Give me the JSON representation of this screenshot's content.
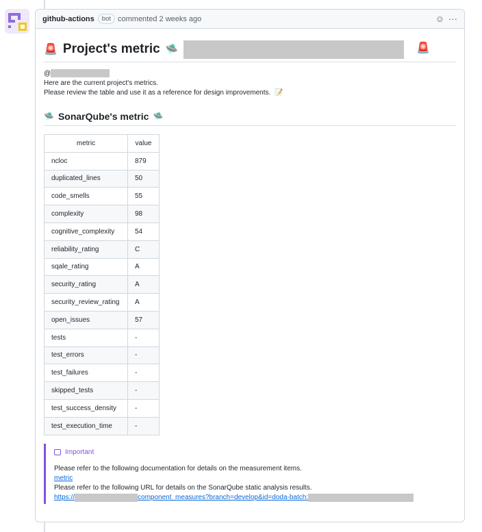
{
  "comment": {
    "author": "github-actions",
    "badge": "bot",
    "action": "commented 2 weeks ago",
    "icons": [
      "smiley-icon",
      "kebab-menu-icon"
    ],
    "icon_glyphs": {
      "smiley": "☺",
      "more": "···"
    }
  },
  "post": {
    "title": "Project's metric",
    "emoji": {
      "siren": "🚨",
      "ufo": "🛸",
      "memo": "📝"
    },
    "mention_prefix": "@",
    "intro_line1": "Here are the current project's metrics.",
    "intro_line2": "Please review the table and use it as a reference for design improvements.",
    "subheading": "SonarQube's metric"
  },
  "table": {
    "headers": [
      "metric",
      "value"
    ],
    "rows": [
      [
        "ncloc",
        "879"
      ],
      [
        "duplicated_lines",
        "50"
      ],
      [
        "code_smells",
        "55"
      ],
      [
        "complexity",
        "98"
      ],
      [
        "cognitive_complexity",
        "54"
      ],
      [
        "reliability_rating",
        "C"
      ],
      [
        "sqale_rating",
        "A"
      ],
      [
        "security_rating",
        "A"
      ],
      [
        "security_review_rating",
        "A"
      ],
      [
        "open_issues",
        "57"
      ],
      [
        "tests",
        "-"
      ],
      [
        "test_errors",
        "-"
      ],
      [
        "test_failures",
        "-"
      ],
      [
        "skipped_tests",
        "-"
      ],
      [
        "test_success_density",
        "-"
      ],
      [
        "test_execution_time",
        "-"
      ]
    ]
  },
  "alert": {
    "title": "Important",
    "line1": "Please refer to the following documentation for details on the measurement items.",
    "link1": "metric",
    "line2": "Please refer to the following URL for details on the SonarQube static analysis results.",
    "url_prefix": "https://",
    "url_middle": "component_measures?branch=develop&id=doda-batch:"
  },
  "colors": {
    "accent_purple": "#8250df",
    "link_blue": "#0969da",
    "border": "#d0d7de"
  }
}
